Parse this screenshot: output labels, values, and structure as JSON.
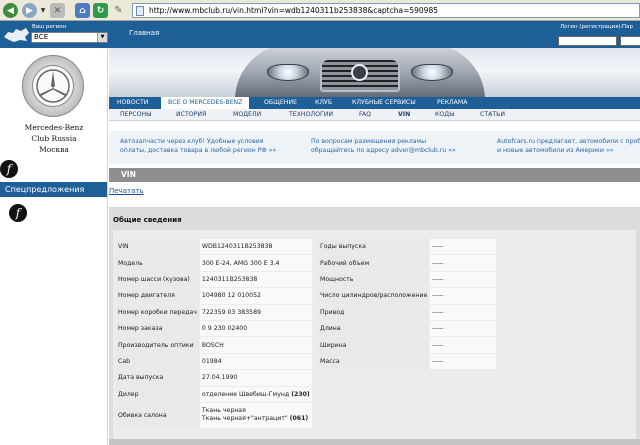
{
  "browser": {
    "url": "http://www.mbclub.ru/vin.html?vin=wdb1240311b253838&captcha=590985"
  },
  "header": {
    "region_label": "Ваш регион",
    "region_value": "ВСЕ",
    "home_link": "Главная",
    "login_label": "Логин (регистрация):",
    "password_label": "Пар"
  },
  "sidebar": {
    "club_line1": "Mercedes-Benz",
    "club_line2": "Club Russia",
    "club_line3": "Москва",
    "special_offers": "Спецпредложения"
  },
  "nav_primary": [
    {
      "label": "НОВОСТИ",
      "active": false
    },
    {
      "label": "ВСЕ О MERCEDES-BENZ",
      "active": true
    },
    {
      "label": "ОБЩЕНИЕ",
      "active": false
    },
    {
      "label": "КЛУБ",
      "active": false
    },
    {
      "label": "КЛУБНЫЕ СЕРВИСЫ",
      "active": false
    },
    {
      "label": "РЕКЛАМА",
      "active": false
    }
  ],
  "nav_secondary": [
    {
      "label": "ПЕРСОНЫ",
      "active": false
    },
    {
      "label": "ИСТОРИЯ",
      "active": false
    },
    {
      "label": "МОДЕЛИ",
      "active": false
    },
    {
      "label": "ТЕХНОЛОГИИ",
      "active": false
    },
    {
      "label": "FAQ",
      "active": false
    },
    {
      "label": "VIN",
      "active": true
    },
    {
      "label": "КОДЫ",
      "active": false
    },
    {
      "label": "СТАТЬИ",
      "active": false
    }
  ],
  "ads": [
    {
      "line1": "Автозапчасти через клуб! Удобные условия",
      "line2": "оплаты, доставка товара в любой регион РФ »»"
    },
    {
      "line1": "По вопросам размещения рекламы",
      "line2": "обращайтесь по адресу adver@mbclub.ru »»"
    },
    {
      "line1": "Autofcars.ru предлагает, автомобили с проб",
      "line2": "и новые автомобили из Америки »»"
    }
  ],
  "vin_section": {
    "title": "VIN",
    "print_link": "Печатать",
    "general_heading": "Общие сведения"
  },
  "specs_left": [
    {
      "label": "VIN",
      "value": "WDB1240311B253838"
    },
    {
      "label": "Модель",
      "value": "300 E-24, AMG 300 E 3.4"
    },
    {
      "label": "Номер шасси (кузова)",
      "value": "1240311B253838"
    },
    {
      "label": "Номер двигателя",
      "value": "104980 12 010052"
    },
    {
      "label": "Номер коробки передач",
      "value": "722359 03 383589"
    },
    {
      "label": "Номер заказа",
      "value": "0 9 230 02400"
    },
    {
      "label": "Производитель оптики",
      "value": "BOSCH"
    },
    {
      "label": "Cab",
      "value": "01984"
    },
    {
      "label": "Дата выпуска",
      "value": "27.04.1990"
    },
    {
      "label": "Дилер",
      "value": "отделение Швебиш-Гмунд ",
      "value_code": "(230)"
    },
    {
      "label": "Обивка салона",
      "value": "Ткань черная",
      "value2": "Ткань черная+\"антрацит\" ",
      "value2_code": "(061)"
    }
  ],
  "specs_right": [
    {
      "label": "Годы выпуска",
      "value": "-----"
    },
    {
      "label": "Рабочий объем",
      "value": "-----"
    },
    {
      "label": "Мощность",
      "value": "-----"
    },
    {
      "label": "Число цилиндров/расположение",
      "value": "-----"
    },
    {
      "label": "Привод",
      "value": "-----"
    },
    {
      "label": "Длина",
      "value": "-----"
    },
    {
      "label": "Ширина",
      "value": "-----"
    },
    {
      "label": "Масса",
      "value": "-----"
    }
  ]
}
